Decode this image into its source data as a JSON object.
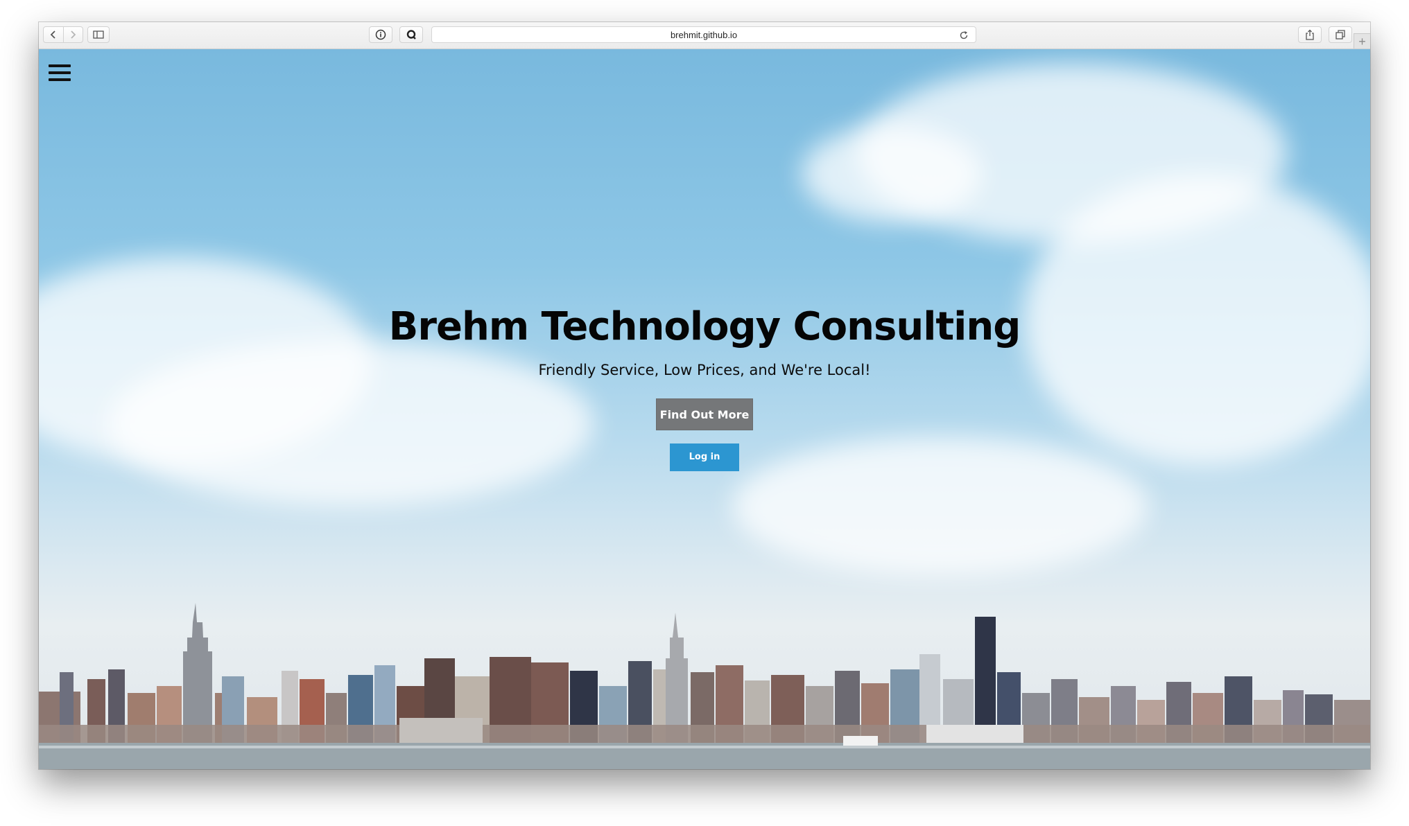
{
  "browser": {
    "url": "brehmit.github.io",
    "new_tab_label": "+",
    "icons": {
      "back": "chevron-left-icon",
      "forward": "chevron-right-icon",
      "sidebar": "sidebar-icon",
      "reader": "info-icon",
      "extension": "search-extension-icon",
      "reload": "reload-icon",
      "share": "share-icon",
      "tabs": "tabs-icon"
    }
  },
  "page": {
    "menu_icon": "hamburger-menu-icon",
    "hero": {
      "title": "Brehm Technology Consulting",
      "tagline": "Friendly Service, Low Prices, and We're Local!",
      "primary_button": "Find Out More",
      "login_button": "Log in"
    },
    "colors": {
      "find_out_more_bg": "#757779",
      "login_bg": "#2c96d1",
      "title_text": "#050505"
    }
  }
}
